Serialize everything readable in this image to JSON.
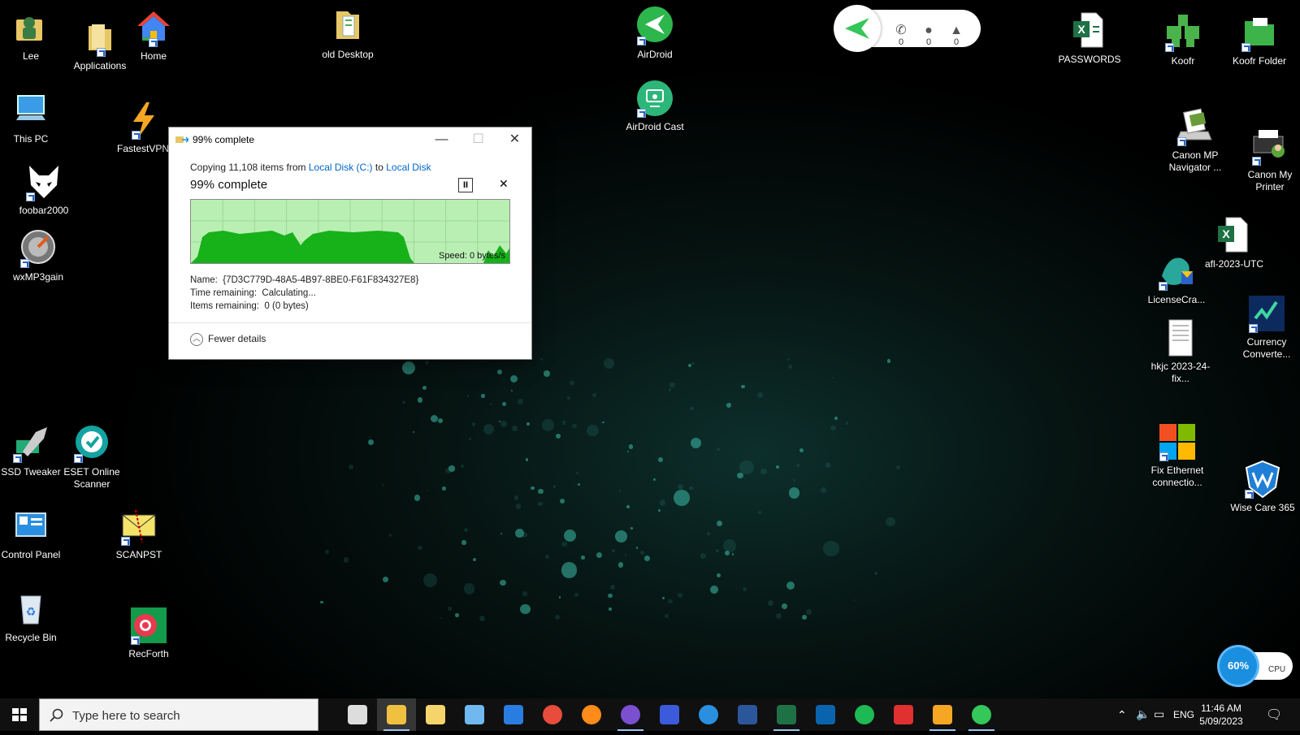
{
  "desktop_icons": [
    {
      "name": "icon-lee",
      "label": "Lee"
    },
    {
      "name": "icon-applications",
      "label": "Applications"
    },
    {
      "name": "icon-home",
      "label": "Home"
    },
    {
      "name": "icon-old-desktop",
      "label": "old Desktop"
    },
    {
      "name": "icon-airdroid",
      "label": "AirDroid"
    },
    {
      "name": "icon-airdroid-cast",
      "label": "AirDroid Cast"
    },
    {
      "name": "icon-this-pc",
      "label": "This PC"
    },
    {
      "name": "icon-fastestvpn",
      "label": "FastestVPN"
    },
    {
      "name": "icon-foobar2000",
      "label": "foobar2000"
    },
    {
      "name": "icon-wxmp3gain",
      "label": "wxMP3gain"
    },
    {
      "name": "icon-ssd-tweaker",
      "label": "SSD Tweaker"
    },
    {
      "name": "icon-eset-online-scanner",
      "label": "ESET Online Scanner"
    },
    {
      "name": "icon-control-panel",
      "label": "Control Panel"
    },
    {
      "name": "icon-scanpst",
      "label": "SCANPST"
    },
    {
      "name": "icon-recycle-bin",
      "label": "Recycle Bin"
    },
    {
      "name": "icon-recforth",
      "label": "RecForth"
    },
    {
      "name": "icon-passwords",
      "label": "PASSWORDS"
    },
    {
      "name": "icon-koofr",
      "label": "Koofr"
    },
    {
      "name": "icon-koofr-folder",
      "label": "Koofr Folder"
    },
    {
      "name": "icon-canon-mp-navigator",
      "label": "Canon MP Navigator ..."
    },
    {
      "name": "icon-canon-my-printer",
      "label": "Canon My Printer"
    },
    {
      "name": "icon-afl-2023-utc",
      "label": "afl-2023-UTC"
    },
    {
      "name": "icon-licensecrawler",
      "label": "LicenseCra..."
    },
    {
      "name": "icon-currency-converter",
      "label": "Currency Converte..."
    },
    {
      "name": "icon-hkjc",
      "label": "hkjc 2023-24-fix..."
    },
    {
      "name": "icon-fix-ethernet",
      "label": "Fix Ethernet connectio..."
    },
    {
      "name": "icon-wise-care-365",
      "label": "Wise Care 365"
    }
  ],
  "airdroid_widget": {
    "calls": "0",
    "messages": "0",
    "notifications": "0",
    "accent": "#34c759"
  },
  "copy_dialog": {
    "title": "99% complete",
    "copying_prefix": "Copying 11,108 items from ",
    "source": "Local Disk (C:)",
    "to_word": " to ",
    "destination": "Local Disk",
    "percent_label": "99% complete",
    "progress_fraction": 0.99,
    "speed_label": "Speed: 0 bytes/s",
    "name_label": "Name:",
    "name_value": "{7D3C779D-48A5-4B97-8BE0-F61F834327E8}",
    "time_label": "Time remaining:",
    "time_value": "Calculating...",
    "items_label": "Items remaining:",
    "items_value": "0 (0 bytes)",
    "fewer_details": "Fewer details",
    "graph_fill": "#17b11a",
    "graph_bg": "#b9efb3"
  },
  "cpu_widget": {
    "percent": "60%",
    "label": "CPU"
  },
  "taskbar": {
    "search_placeholder": "Type here to search",
    "apps": [
      "task-view",
      "file-explorer",
      "sticky-notes",
      "paint-3d",
      "microsoft-store",
      "chrome",
      "firefox",
      "viber",
      "app-m",
      "ccleaner",
      "word",
      "excel",
      "outlook",
      "spotify",
      "app-updown",
      "fastestvpn",
      "airdroid"
    ],
    "language": "ENG",
    "time": "11:46 AM",
    "date": "5/09/2023"
  }
}
